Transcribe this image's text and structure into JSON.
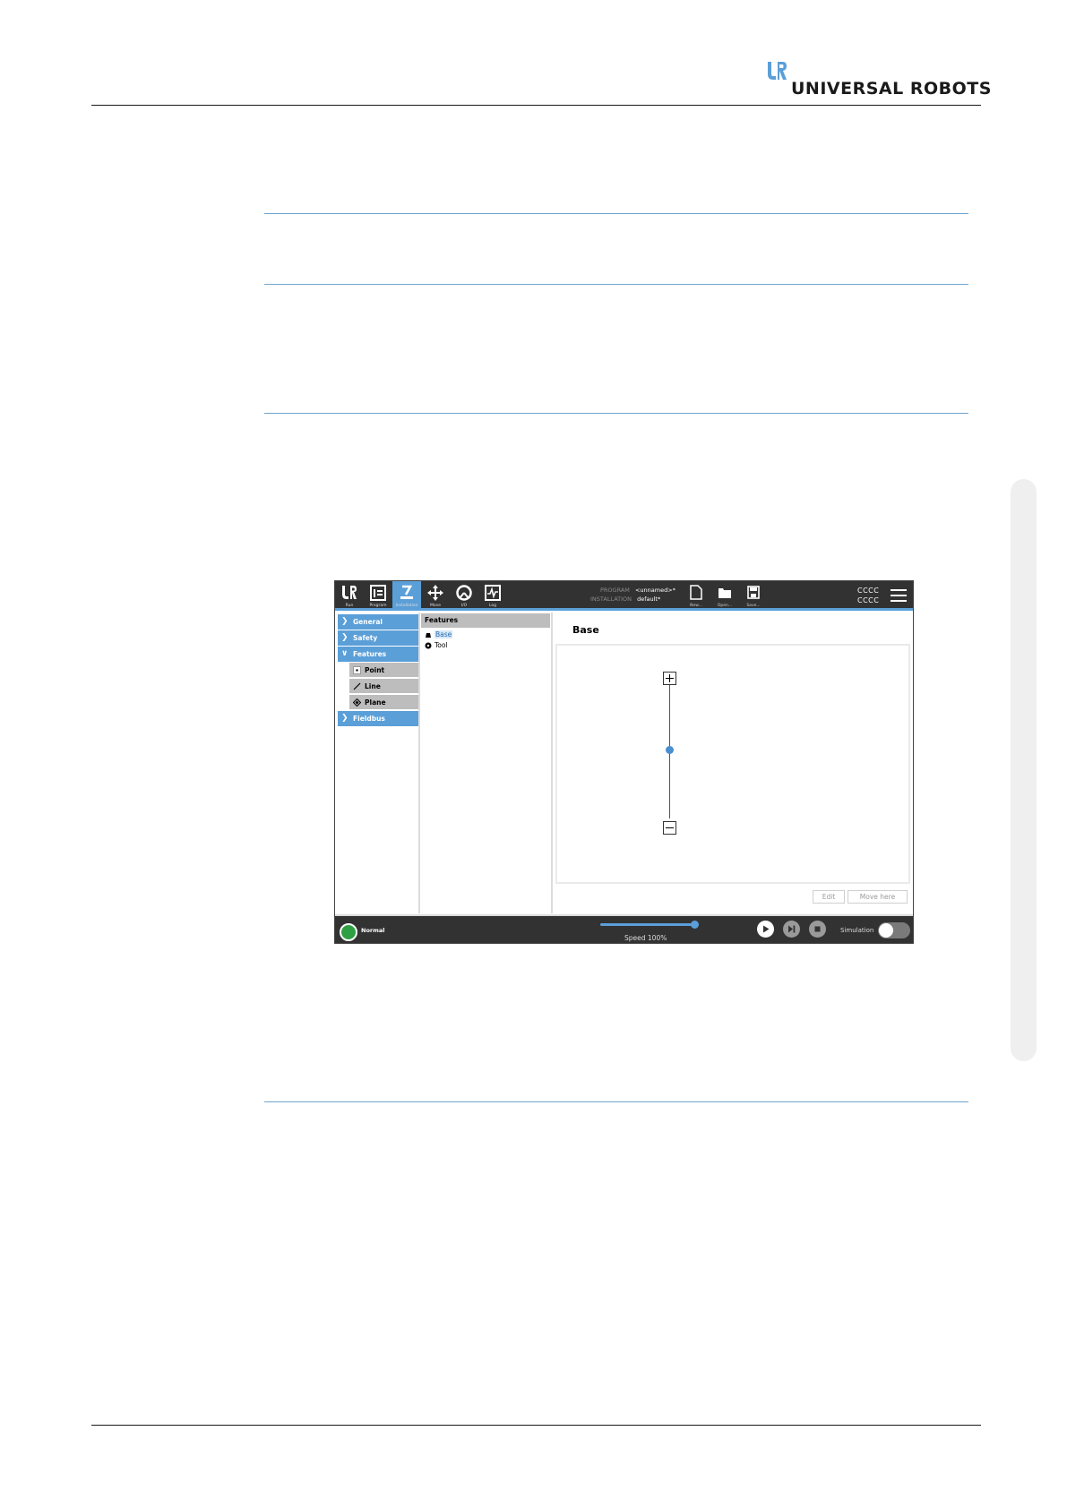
{
  "header": {
    "brand": "UNIVERSAL ROBOTS",
    "logo_icon": "ur-logo-icon"
  },
  "screenshot": {
    "nav": {
      "run": "Run",
      "program": "Program",
      "installation": "Installation",
      "move": "Move",
      "io": "I/O",
      "log": "Log"
    },
    "program_info": {
      "program_key": "PROGRAM",
      "program_value": "<unnamed>*",
      "installation_key": "INSTALLATION",
      "installation_value": "default*"
    },
    "file_buttons": {
      "new": "New...",
      "open": "Open...",
      "save": "Save..."
    },
    "top_right": {
      "line1": "CCCC",
      "line2": "CCCC"
    },
    "menu": {
      "general": "General",
      "safety": "Safety",
      "features": "Features",
      "point": "Point",
      "line": "Line",
      "plane": "Plane",
      "fieldbus": "Fieldbus"
    },
    "tree": {
      "header": "Features",
      "base": "Base",
      "tool": "Tool"
    },
    "main": {
      "title": "Base",
      "edit_button": "Edit",
      "move_here_button": "Move here"
    },
    "status": {
      "label": "Normal",
      "color": "#2ea043"
    },
    "speed": {
      "label": "Speed 100%",
      "value_percent": 100
    },
    "simulation": {
      "label": "Simulation",
      "enabled": false
    },
    "colors": {
      "accent": "#5b9fd8",
      "bar": "#323232"
    }
  }
}
